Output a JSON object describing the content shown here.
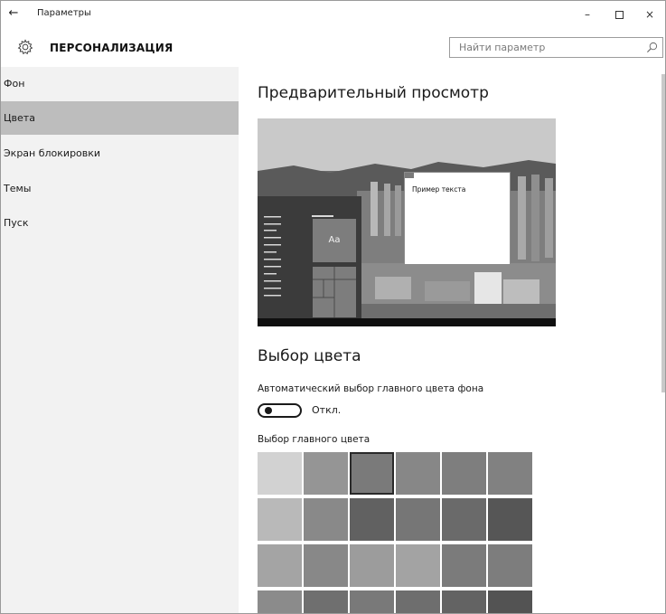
{
  "window": {
    "title": "Параметры",
    "back_glyph": "←",
    "minimize_glyph": "–",
    "close_glyph": "×"
  },
  "header": {
    "title": "ПЕРСОНАЛИЗАЦИЯ",
    "icon": "gear-icon"
  },
  "search": {
    "placeholder": "Найти параметр",
    "value": "",
    "icon": "search-icon"
  },
  "sidebar": {
    "items": [
      {
        "label": "Фон",
        "active": false
      },
      {
        "label": "Цвета",
        "active": true
      },
      {
        "label": "Экран блокировки",
        "active": false
      },
      {
        "label": "Темы",
        "active": false
      },
      {
        "label": "Пуск",
        "active": false
      }
    ]
  },
  "main": {
    "preview_heading": "Предварительный просмотр",
    "preview_tile_label": "Aa",
    "preview_sample_text": "Пример текста",
    "color_heading": "Выбор цвета",
    "auto_accent_label": "Автоматический выбор главного цвета фона",
    "toggle_state": "Откл.",
    "toggle_on": false,
    "accent_label": "Выбор главного цвета"
  },
  "swatches": [
    [
      "#d2d2d2",
      "#959595",
      "#7a7a7a",
      "#878787",
      "#7e7e7e",
      "#818181"
    ],
    [
      "#b9b9b9",
      "#898989",
      "#616161",
      "#767676",
      "#6a6a6a",
      "#565656"
    ],
    [
      "#a4a4a4",
      "#888888",
      "#9c9c9c",
      "#a3a3a3",
      "#7b7b7b",
      "#7d7d7d"
    ],
    [
      "#8b8b8b",
      "#6f6f6f",
      "#797979",
      "#6e6e6e",
      "#636363",
      "#535353"
    ]
  ],
  "selected_swatch": {
    "row": 0,
    "col": 2
  },
  "colors": {
    "sidebar_bg": "#f2f2f2",
    "active_item_bg": "#bdbdbd",
    "preview_start_bg": "#3b3b3b",
    "accent_tile": "#7d7d7d"
  }
}
